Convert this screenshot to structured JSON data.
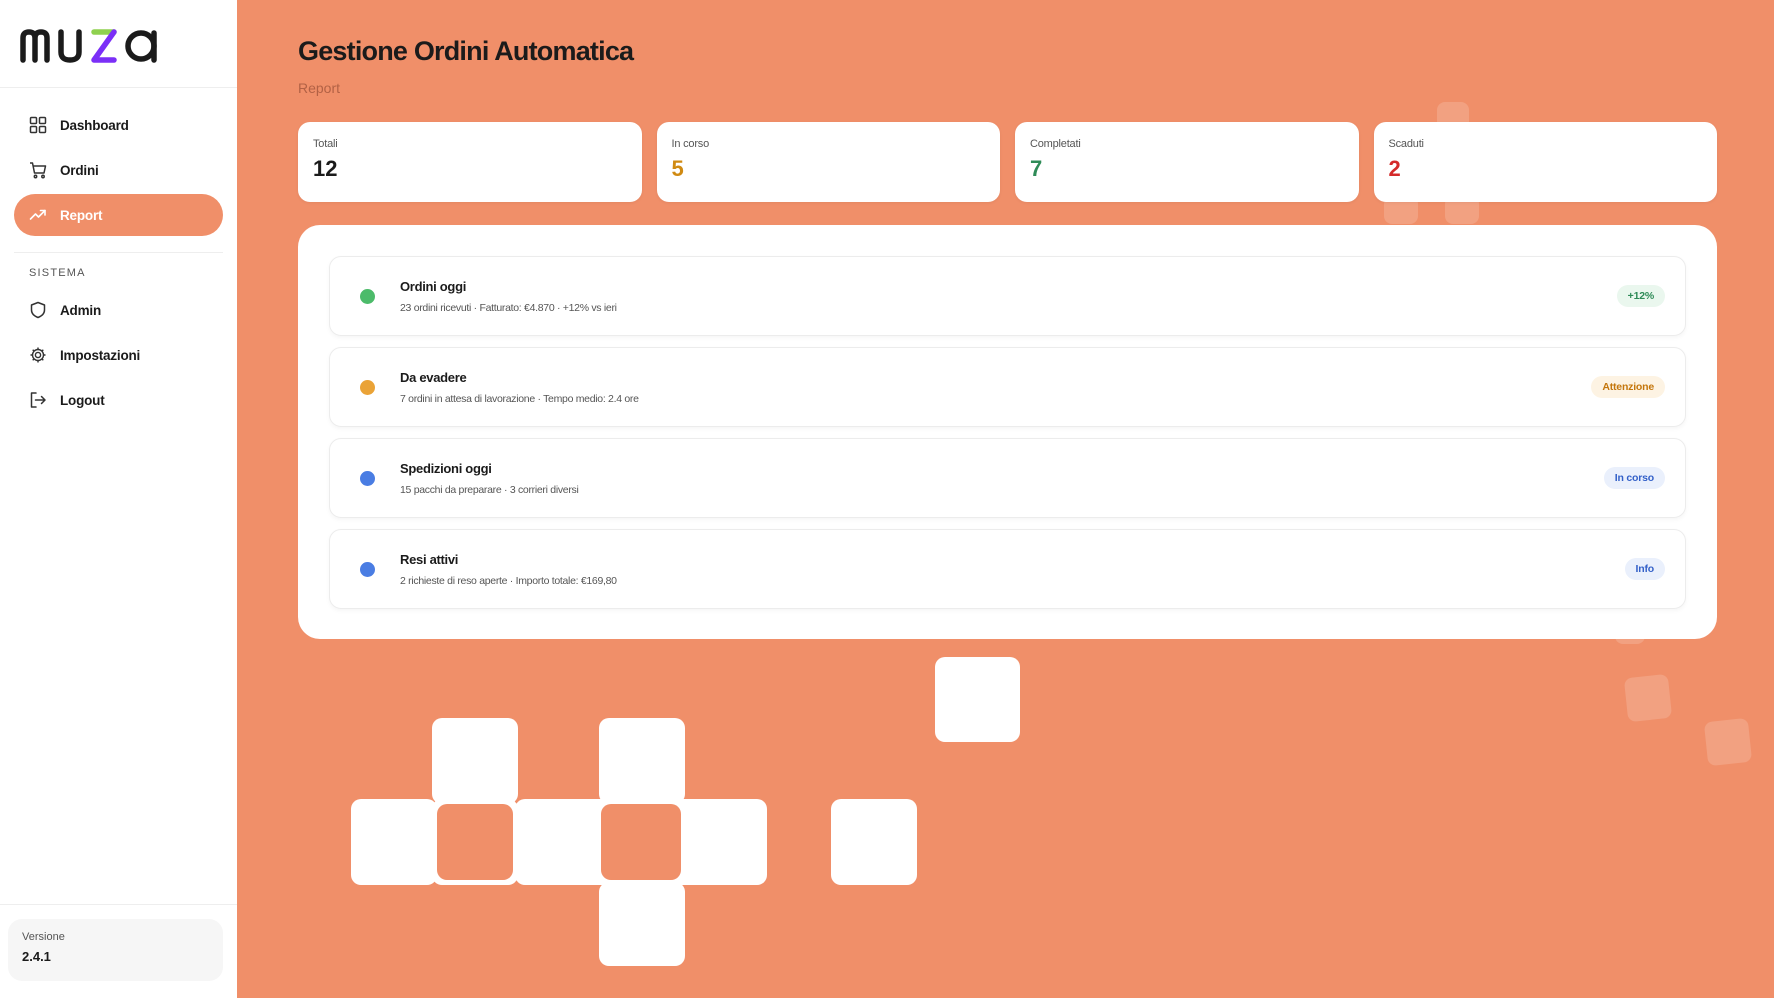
{
  "brand": {
    "logo_text": "muza",
    "accent_colors": [
      "#7b2ff7",
      "#8fd14f"
    ]
  },
  "sidebar": {
    "items": [
      {
        "label": "Dashboard",
        "icon": "grid-icon",
        "active": false
      },
      {
        "label": "Ordini",
        "icon": "cart-icon",
        "active": false
      },
      {
        "label": "Report",
        "icon": "trend-icon",
        "active": true
      }
    ],
    "section_label": "SISTEMA",
    "system_items": [
      {
        "label": "Admin",
        "icon": "shield-icon"
      },
      {
        "label": "Impostazioni",
        "icon": "gear-icon"
      },
      {
        "label": "Logout",
        "icon": "logout-icon"
      }
    ],
    "version_label": "Versione",
    "version_value": "2.4.1"
  },
  "header": {
    "title": "Gestione Ordini Automatica",
    "subtitle": "Report"
  },
  "stats": [
    {
      "label": "Totali",
      "value": "12",
      "color": "#1b1b1b"
    },
    {
      "label": "In corso",
      "value": "5",
      "color": "#d08a12"
    },
    {
      "label": "Completati",
      "value": "7",
      "color": "#2e8b57"
    },
    {
      "label": "Scaduti",
      "value": "2",
      "color": "#d42a2a"
    }
  ],
  "report_items": [
    {
      "title": "Ordini oggi",
      "description": "23 ordini ricevuti · Fatturato: €4.870 · +12% vs ieri",
      "dot_color": "#4cbb6a",
      "badge": "+12%",
      "badge_color": "#2e8b57",
      "badge_bg": "#eaf7ee"
    },
    {
      "title": "Da evadere",
      "description": "7 ordini in attesa di lavorazione · Tempo medio: 2.4 ore",
      "dot_color": "#eaa337",
      "badge": "Attenzione",
      "badge_color": "#c4760c",
      "badge_bg": "#fdf3e3"
    },
    {
      "title": "Spedizioni oggi",
      "description": "15 pacchi da preparare · 3 corrieri diversi",
      "dot_color": "#4a7de3",
      "badge": "In corso",
      "badge_color": "#3461c9",
      "badge_bg": "#eaf0fc"
    },
    {
      "title": "Resi attivi",
      "description": "2 richieste di reso aperte · Importo totale: €169,80",
      "dot_color": "#4a7de3",
      "badge": "Info",
      "badge_color": "#3461c9",
      "badge_bg": "#eaf0fc"
    }
  ]
}
